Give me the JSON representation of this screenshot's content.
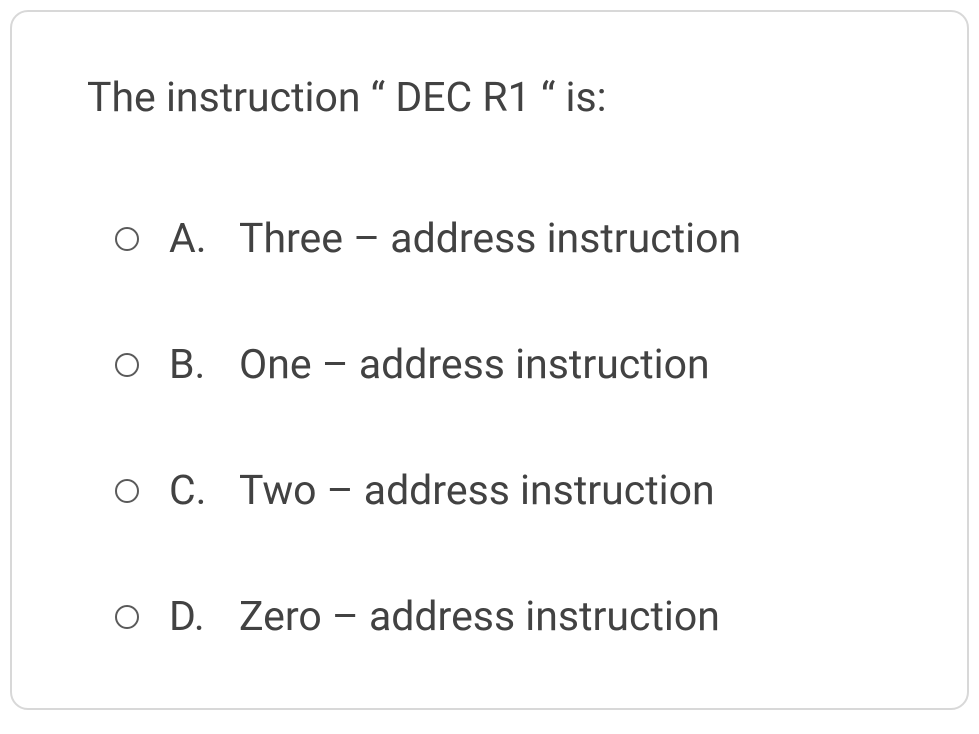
{
  "question": {
    "text": "The instruction “ DEC R1 “   is:",
    "options": [
      {
        "letter": "A.",
        "text": "Three – address instruction"
      },
      {
        "letter": "B.",
        "text": "One – address instruction"
      },
      {
        "letter": "C.",
        "text": "Two – address instruction"
      },
      {
        "letter": "D.",
        "text": "Zero – address instruction"
      }
    ]
  }
}
